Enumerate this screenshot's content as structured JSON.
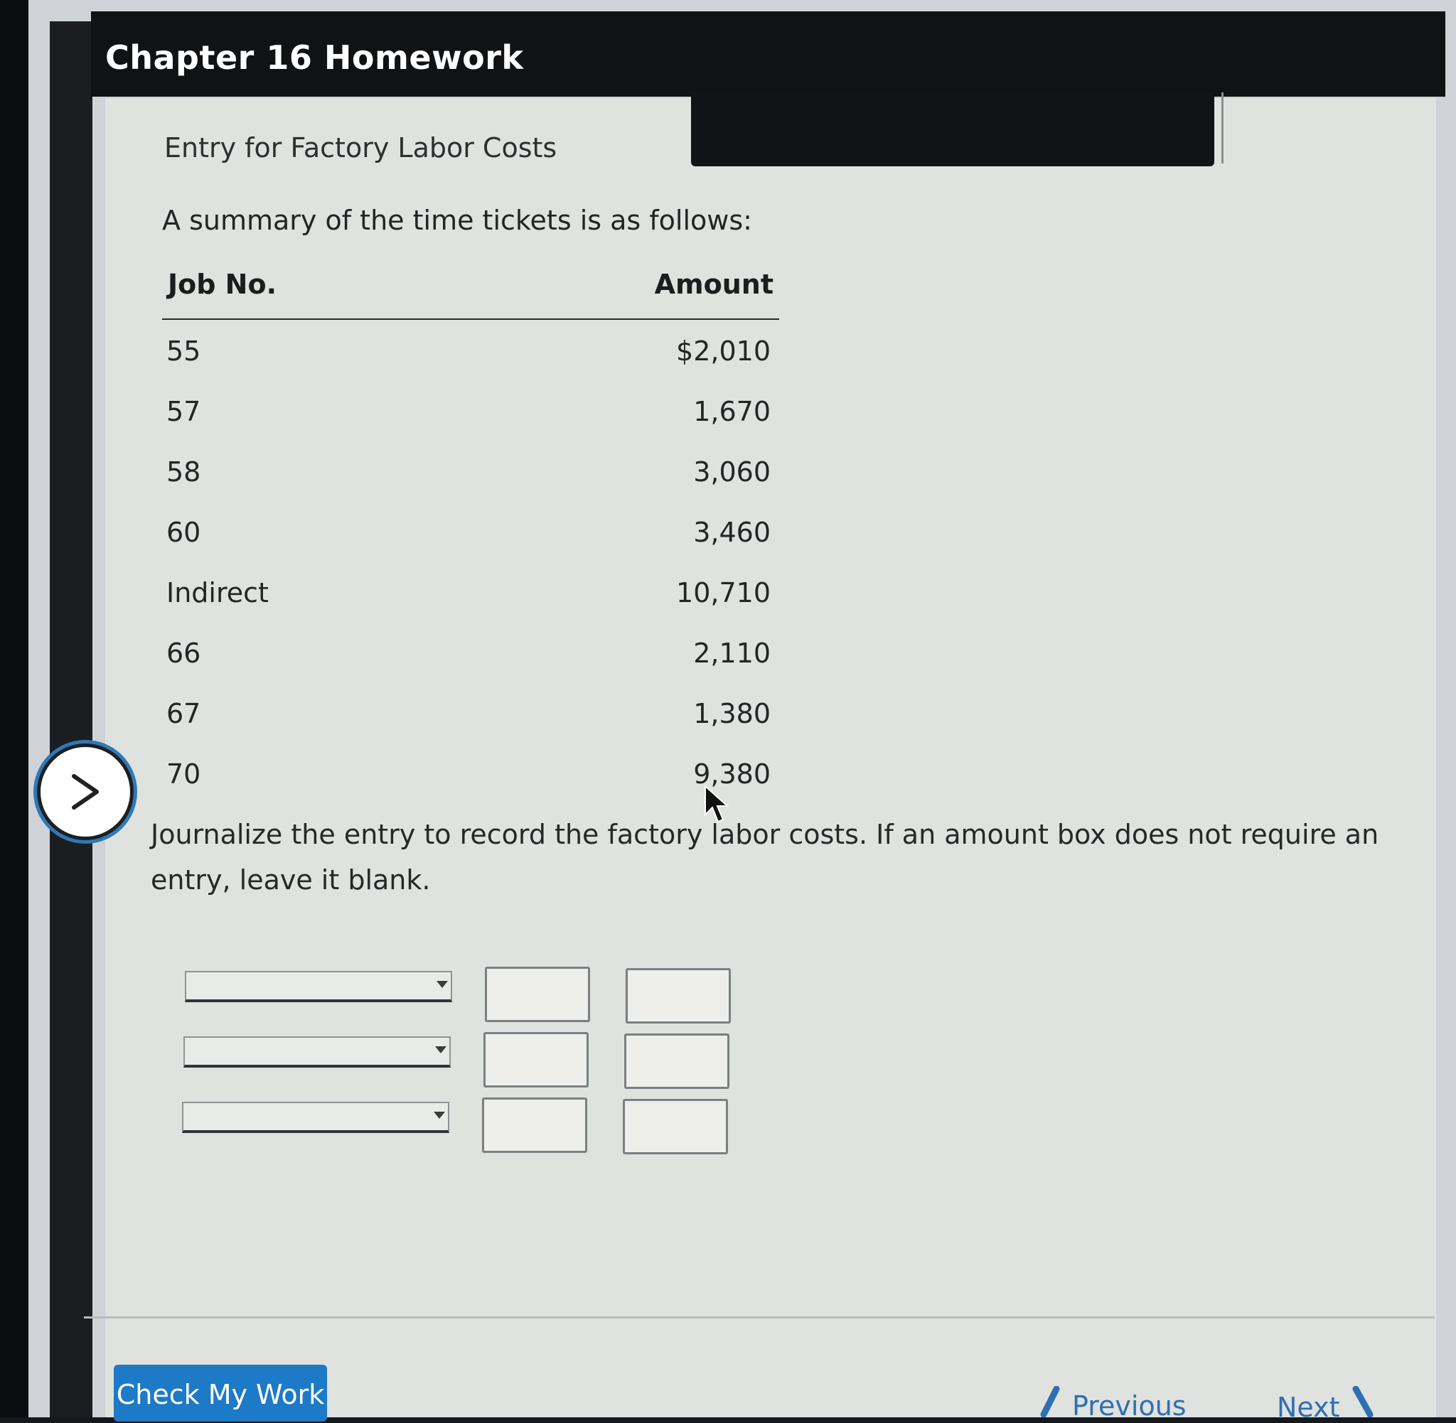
{
  "header": {
    "title": "Chapter 16 Homework"
  },
  "problem": {
    "subtitle": "Entry for Factory Labor Costs",
    "summary": "A summary of the time tickets is as follows:",
    "table": {
      "headers": {
        "job": "Job No.",
        "amount": "Amount"
      },
      "rows": [
        {
          "job": "55",
          "amount": "$2,010"
        },
        {
          "job": "57",
          "amount": "1,670"
        },
        {
          "job": "58",
          "amount": "3,060"
        },
        {
          "job": "60",
          "amount": "3,460"
        },
        {
          "job": "Indirect",
          "amount": "10,710"
        },
        {
          "job": "66",
          "amount": "2,110"
        },
        {
          "job": "67",
          "amount": "1,380"
        },
        {
          "job": "70",
          "amount": "9,380"
        }
      ]
    },
    "instructions": "Journalize the entry to record the factory labor costs. If an amount box does not require an entry, leave it blank."
  },
  "journal": {
    "rows": [
      {
        "account": "",
        "debit": "",
        "credit": ""
      },
      {
        "account": "",
        "debit": "",
        "credit": ""
      },
      {
        "account": "",
        "debit": "",
        "credit": ""
      }
    ]
  },
  "footer": {
    "check_label": "Check My Work",
    "previous_label": "Previous",
    "next_label": "Next"
  },
  "icons": {
    "expand": "chevron-right-icon",
    "cursor": "mouse-pointer-icon"
  },
  "colors": {
    "accent": "#1d7ac6",
    "title_bar": "#111214",
    "content_bg": "#dfe2de"
  }
}
